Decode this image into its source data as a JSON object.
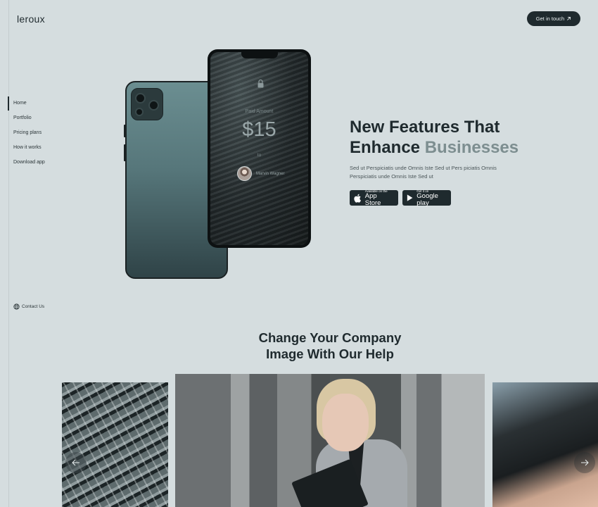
{
  "brand": {
    "logo": "leroux"
  },
  "header": {
    "cta_label": "Get in touch",
    "cta_icon": "arrow-up-right-icon"
  },
  "nav": {
    "items": [
      {
        "label": "Home",
        "active": true
      },
      {
        "label": "Portfolio"
      },
      {
        "label": "Pricing plans"
      },
      {
        "label": "How it works"
      },
      {
        "label": "Download app"
      }
    ],
    "contact_label": "Contact Us",
    "contact_icon": "globe-icon"
  },
  "phone": {
    "paid_label": "Paid Amount",
    "amount": "$15",
    "to_label": "to",
    "payee_name": "Marvin Wagner"
  },
  "hero": {
    "title_line1": "New Features That",
    "title_line2_plain": "Enhance ",
    "title_line2_accent": "Businesses",
    "description": "Sed ut Perspiciatis unde Omnis Iste Sed ut Pers piciatis Omnis Perspiciatis unde Omnis Iste Sed ut",
    "app_store": {
      "small": "Available on the",
      "big": "App Store"
    },
    "google_play": {
      "small": "Get it on",
      "big": "Google play"
    }
  },
  "section": {
    "title_line1": "Change Your Company",
    "title_line2": "Image With Our Help"
  },
  "slider": {
    "prev_icon": "arrow-left-icon",
    "next_icon": "arrow-right-icon"
  },
  "colors": {
    "background": "#d5dddf",
    "dark": "#1f2a2e",
    "accent": "#7d8e90"
  }
}
